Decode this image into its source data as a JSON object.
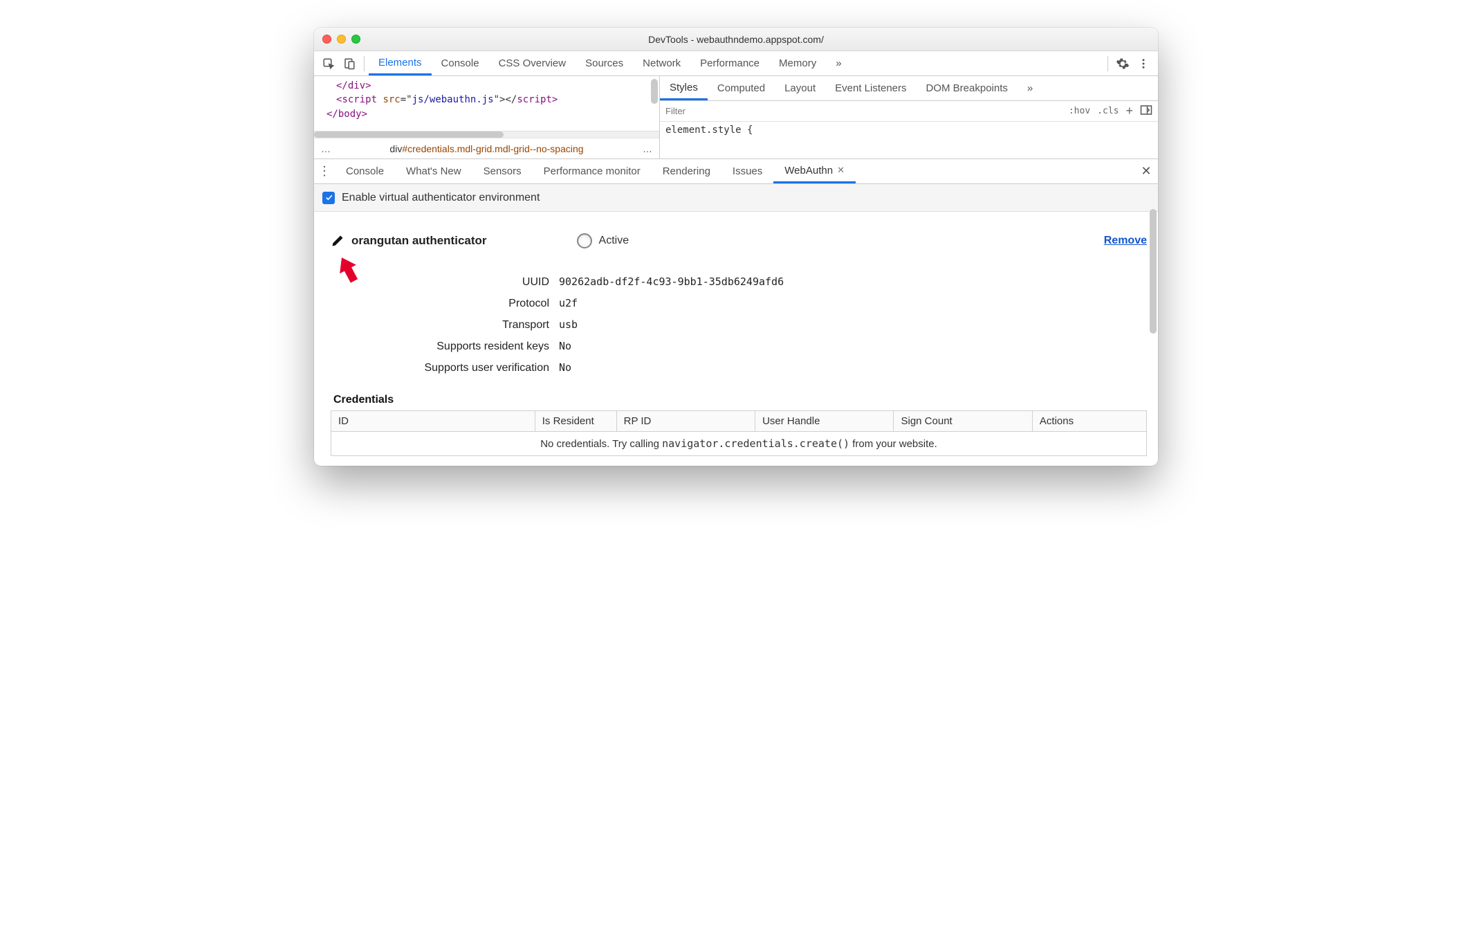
{
  "title": "DevTools - webauthndemo.appspot.com/",
  "main_tabs": {
    "elements": "Elements",
    "console": "Console",
    "css_overview": "CSS Overview",
    "sources": "Sources",
    "network": "Network",
    "performance": "Performance",
    "memory": "Memory",
    "more": "»"
  },
  "code": {
    "l1a": "</",
    "l1b": "div",
    "l1c": ">",
    "l2a": "<",
    "l2b": "script ",
    "l2c": "src",
    "l2d": "=\"",
    "l2e": "js/webauthn.js",
    "l2f": "\"></",
    "l2g": "script",
    "l2h": ">",
    "l3a": "</",
    "l3b": "body",
    "l3c": ">"
  },
  "crumb": {
    "ellipsis_l": "…",
    "main": "div",
    "id": "#credentials",
    "cls": ".mdl-grid.mdl-grid--no-spacing",
    "ellipsis_r": "…"
  },
  "sub_tabs": {
    "styles": "Styles",
    "computed": "Computed",
    "layout": "Layout",
    "listeners": "Event Listeners",
    "dom_bp": "DOM Breakpoints",
    "more": "»"
  },
  "filter": {
    "placeholder": "Filter",
    "hov": ":hov",
    "cls": ".cls",
    "plus": "+"
  },
  "style_rule": "element.style {",
  "drawer": {
    "console": "Console",
    "whatsnew": "What's New",
    "sensors": "Sensors",
    "perfmon": "Performance monitor",
    "rendering": "Rendering",
    "issues": "Issues",
    "webauthn": "WebAuthn"
  },
  "enable_label": "Enable virtual authenticator environment",
  "authenticator": {
    "name": "orangutan authenticator",
    "active_label": "Active",
    "remove": "Remove",
    "props": {
      "uuid_label": "UUID",
      "uuid": "90262adb-df2f-4c93-9bb1-35db6249afd6",
      "protocol_label": "Protocol",
      "protocol": "u2f",
      "transport_label": "Transport",
      "transport": "usb",
      "rk_label": "Supports resident keys",
      "rk": "No",
      "uv_label": "Supports user verification",
      "uv": "No"
    }
  },
  "credentials": {
    "title": "Credentials",
    "headers": {
      "id": "ID",
      "is_resident": "Is Resident",
      "rp_id": "RP ID",
      "user_handle": "User Handle",
      "sign_count": "Sign Count",
      "actions": "Actions"
    },
    "empty_pre": "No credentials. Try calling ",
    "empty_code": "navigator.credentials.create()",
    "empty_post": " from your website."
  }
}
